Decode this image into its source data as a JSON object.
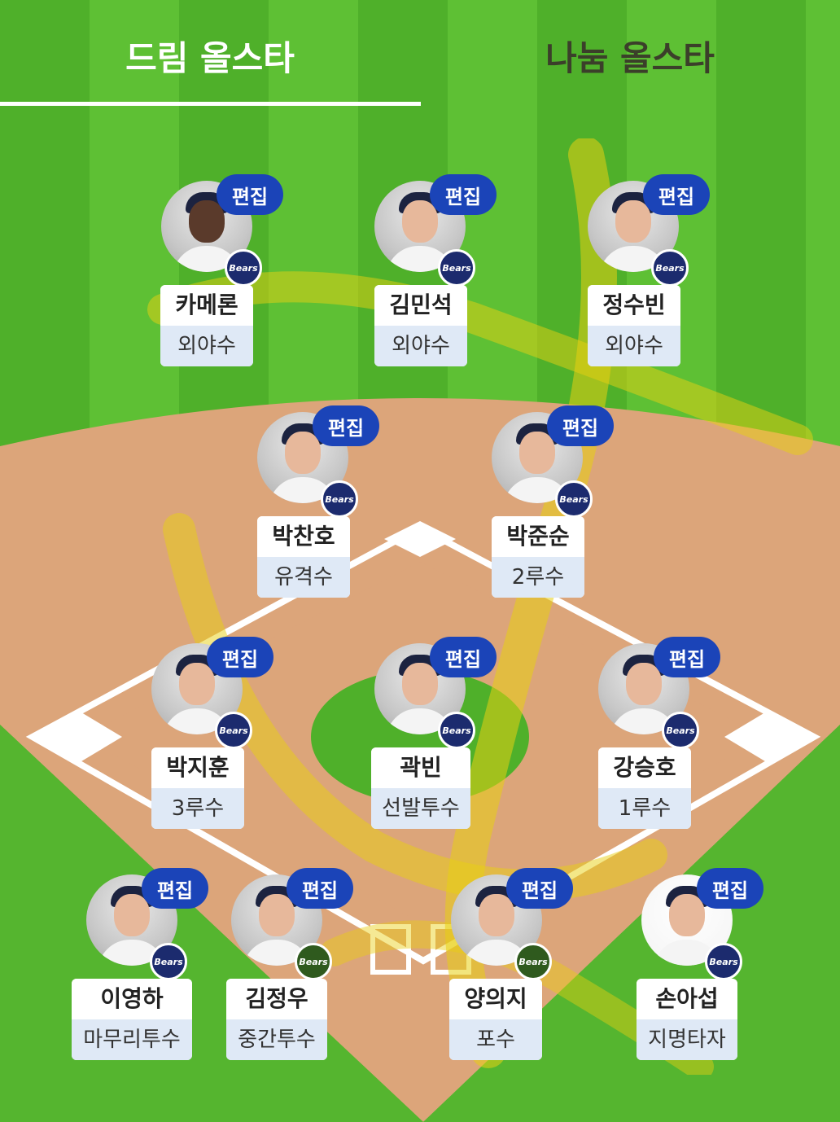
{
  "tabs": [
    {
      "label": "드림 올스타",
      "active": true
    },
    {
      "label": "나눔 올스타",
      "active": false
    }
  ],
  "edit_label": "편집",
  "team_badge": "Bears",
  "colors": {
    "grass_light": "#5ec034",
    "grass_dark": "#4fb02a",
    "infield_dirt": "#dca57a",
    "edit_button": "#1b44b8",
    "position_bg": "#dfe9f6"
  },
  "players": {
    "lf": {
      "name": "카메론",
      "position": "외야수"
    },
    "cf": {
      "name": "김민석",
      "position": "외야수"
    },
    "rf": {
      "name": "정수빈",
      "position": "외야수"
    },
    "ss": {
      "name": "박찬호",
      "position": "유격수"
    },
    "b2": {
      "name": "박준순",
      "position": "2루수"
    },
    "b3": {
      "name": "박지훈",
      "position": "3루수"
    },
    "p": {
      "name": "곽빈",
      "position": "선발투수"
    },
    "b1": {
      "name": "강승호",
      "position": "1루수"
    },
    "cl": {
      "name": "이영하",
      "position": "마무리투수"
    },
    "rp": {
      "name": "김정우",
      "position": "중간투수"
    },
    "c": {
      "name": "양의지",
      "position": "포수"
    },
    "dh": {
      "name": "손아섭",
      "position": "지명타자"
    }
  }
}
